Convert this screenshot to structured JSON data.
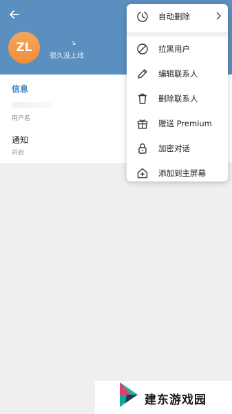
{
  "profile": {
    "avatar_initials": "ZL",
    "name_fragment": "ъ",
    "last_seen": "很久没上线"
  },
  "info": {
    "section_title": "信息",
    "username_label": "用户名",
    "notifications_label": "通知",
    "notifications_value": "开启"
  },
  "menu": {
    "items": [
      {
        "label": "自动删除",
        "icon": "auto-delete-timer-icon"
      },
      {
        "label": "拉黑用户",
        "icon": "block-icon"
      },
      {
        "label": "编辑联系人",
        "icon": "pencil-icon"
      },
      {
        "label": "删除联系人",
        "icon": "trash-icon"
      },
      {
        "label": "赠送 Premium",
        "icon": "gift-icon"
      },
      {
        "label": "加密对话",
        "icon": "lock-icon"
      },
      {
        "label": "添加到主屏幕",
        "icon": "add-to-home-icon"
      }
    ]
  },
  "watermark": {
    "text": "建东游戏园"
  },
  "colors": {
    "header": "#5b8fbf",
    "accent": "#3b82c4",
    "avatar": "#f09640"
  }
}
